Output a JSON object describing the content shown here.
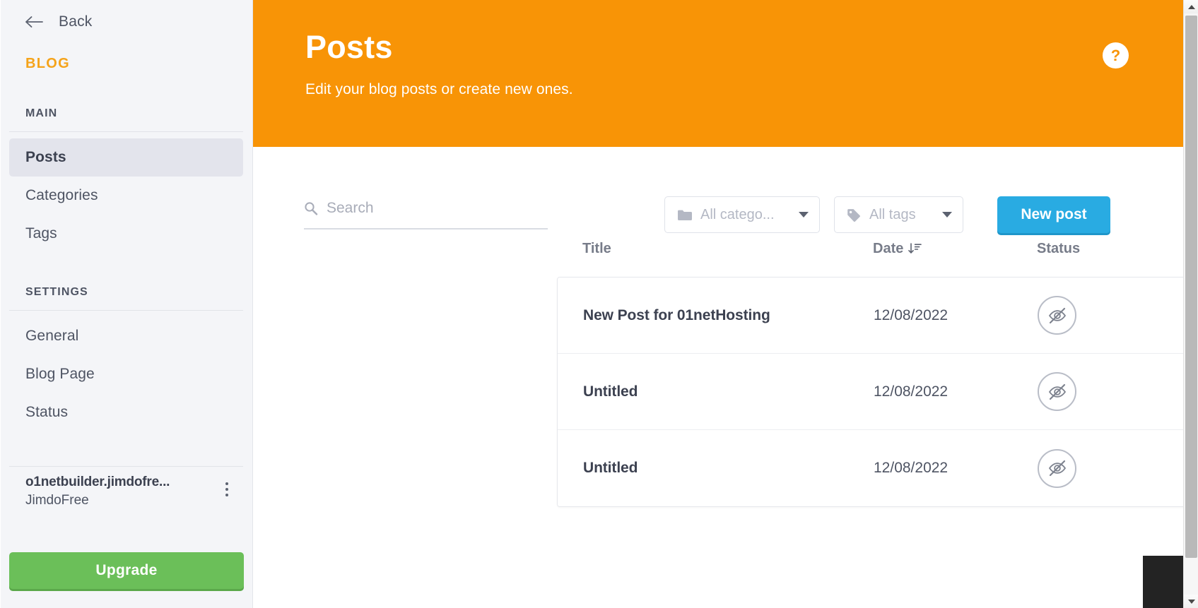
{
  "sidebar": {
    "back_label": "Back",
    "brand": "BLOG",
    "sections": [
      {
        "label": "MAIN",
        "items": [
          {
            "label": "Posts",
            "active": true
          },
          {
            "label": "Categories",
            "active": false
          },
          {
            "label": "Tags",
            "active": false
          }
        ]
      },
      {
        "label": "SETTINGS",
        "items": [
          {
            "label": "General",
            "active": false
          },
          {
            "label": "Blog Page",
            "active": false
          },
          {
            "label": "Status",
            "active": false
          }
        ]
      }
    ],
    "site": {
      "name": "o1netbuilder.jimdofre...",
      "plan": "JimdoFree",
      "menu_icon": "kebab-menu-icon"
    },
    "upgrade_label": "Upgrade",
    "accent_color": "#f5a31a",
    "upgrade_color": "#6bbf59"
  },
  "header": {
    "title": "Posts",
    "subtitle": "Edit your blog posts or create new ones.",
    "help_label": "?",
    "background_color": "#f89406"
  },
  "toolbar": {
    "search_placeholder": "Search",
    "search_value": "",
    "search_icon": "search-icon",
    "categories_select": {
      "label": "All catego...",
      "icon": "folder-icon"
    },
    "tags_select": {
      "label": "All tags",
      "icon": "tag-icon"
    },
    "new_post_label": "New post",
    "new_post_color": "#29abe2"
  },
  "table": {
    "columns": {
      "title": "Title",
      "date": "Date",
      "status": "Status"
    },
    "sort_icon": "sort-descending-icon",
    "rows": [
      {
        "title": "New Post for 01netHosting",
        "date": "12/08/2022",
        "status_icon": "eye-off-icon",
        "edit_icon": "edit-icon",
        "menu_icon": "kebab-menu-icon"
      },
      {
        "title": "Untitled",
        "date": "12/08/2022",
        "status_icon": "eye-off-icon",
        "edit_icon": "edit-icon",
        "menu_icon": "kebab-menu-icon"
      },
      {
        "title": "Untitled",
        "date": "12/08/2022",
        "status_icon": "eye-off-icon",
        "edit_icon": "edit-icon",
        "menu_icon": "kebab-menu-icon"
      }
    ]
  }
}
